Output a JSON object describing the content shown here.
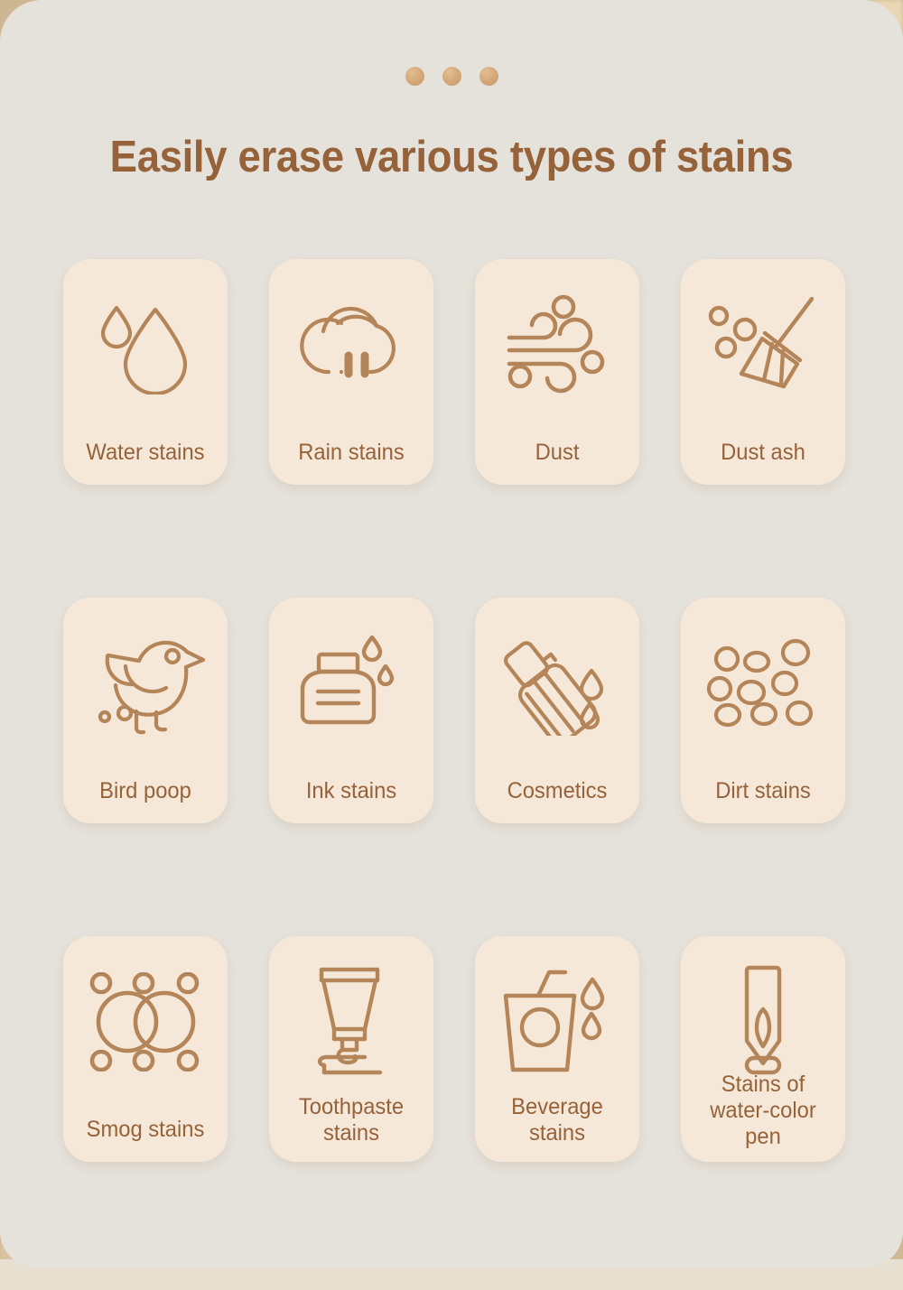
{
  "page": {
    "title": "Easily erase various types of stains",
    "background_color": "#E5E2DB",
    "tile_color": "#F6E8D8",
    "accent_color": "#96623A",
    "icon_stroke_color": "#B5855A",
    "dot_color": "#D3A777"
  },
  "decor": {
    "dots": [
      "dot-1",
      "dot-2",
      "dot-3"
    ]
  },
  "tiles": [
    {
      "label": "Water stains",
      "icon": "water-drops-icon",
      "lines": 1
    },
    {
      "label": "Rain stains",
      "icon": "rain-cloud-icon",
      "lines": 1
    },
    {
      "label": "Dust",
      "icon": "wind-dust-icon",
      "lines": 1
    },
    {
      "label": "Dust ash",
      "icon": "broom-icon",
      "lines": 1
    },
    {
      "label": "Bird poop",
      "icon": "bird-icon",
      "lines": 1
    },
    {
      "label": "Ink stains",
      "icon": "ink-bottle-icon",
      "lines": 1
    },
    {
      "label": "Cosmetics",
      "icon": "cosmetic-bottle-icon",
      "lines": 1
    },
    {
      "label": "Dirt stains",
      "icon": "dirt-specks-icon",
      "lines": 1
    },
    {
      "label": "Smog stains",
      "icon": "smog-circles-icon",
      "lines": 1
    },
    {
      "label": "Toothpaste\nstains",
      "icon": "toothpaste-tube-icon",
      "lines": 2
    },
    {
      "label": "Beverage\nstains",
      "icon": "beverage-cup-icon",
      "lines": 2
    },
    {
      "label": "Stains of\nwater-color\npen",
      "icon": "marker-pen-icon",
      "lines": 3
    }
  ]
}
